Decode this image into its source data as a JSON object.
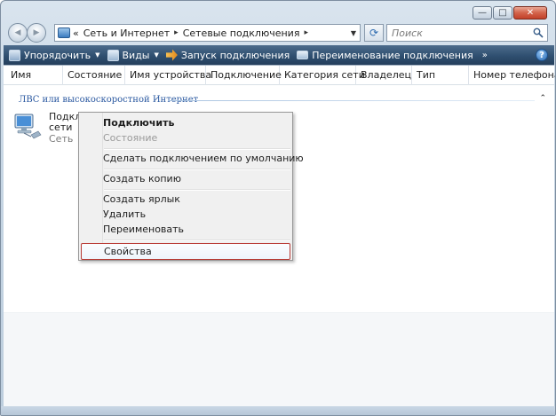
{
  "window": {
    "caption_buttons": {
      "minimize": "—",
      "maximize": "□",
      "close": "✕"
    }
  },
  "address_bar": {
    "prefix": "«",
    "crumbs": [
      "Сеть и Интернет",
      "Сетевые подключения"
    ],
    "separator": "▸",
    "dropdown_icon": "chevron-down-icon"
  },
  "search": {
    "placeholder": "Поиск"
  },
  "toolbar": {
    "organize": "Упорядочить",
    "views": "Виды",
    "launch": "Запуск подключения",
    "rename": "Переименование подключения",
    "more": "»",
    "help": "?"
  },
  "columns": [
    "Имя",
    "Состояние",
    "Имя устройства",
    "Подключение",
    "Категория сети",
    "Владелец",
    "Тип",
    "Номер телефона..."
  ],
  "group": {
    "title": "ЛВС или высокоскоростной Интернет",
    "collapse": "⌃"
  },
  "item": {
    "name_line1": "Подклю",
    "name_line2": "сети",
    "subtitle": "Сеть"
  },
  "context_menu": {
    "items": [
      {
        "label": "Подключить",
        "style": "bold"
      },
      {
        "label": "Состояние",
        "style": "disabled"
      },
      {
        "label": "Сделать подключением по умолчанию",
        "style": "normal"
      },
      {
        "label": "Создать копию",
        "style": "normal"
      },
      {
        "label": "Создать ярлык",
        "style": "normal"
      },
      {
        "label": "Удалить",
        "style": "normal"
      },
      {
        "label": "Переименовать",
        "style": "normal"
      },
      {
        "label": "Свойства",
        "style": "highlight"
      }
    ]
  },
  "colors": {
    "toolbar": "#2f4f70",
    "group_header": "#2a58a0",
    "highlight_border": "#b83a34"
  }
}
